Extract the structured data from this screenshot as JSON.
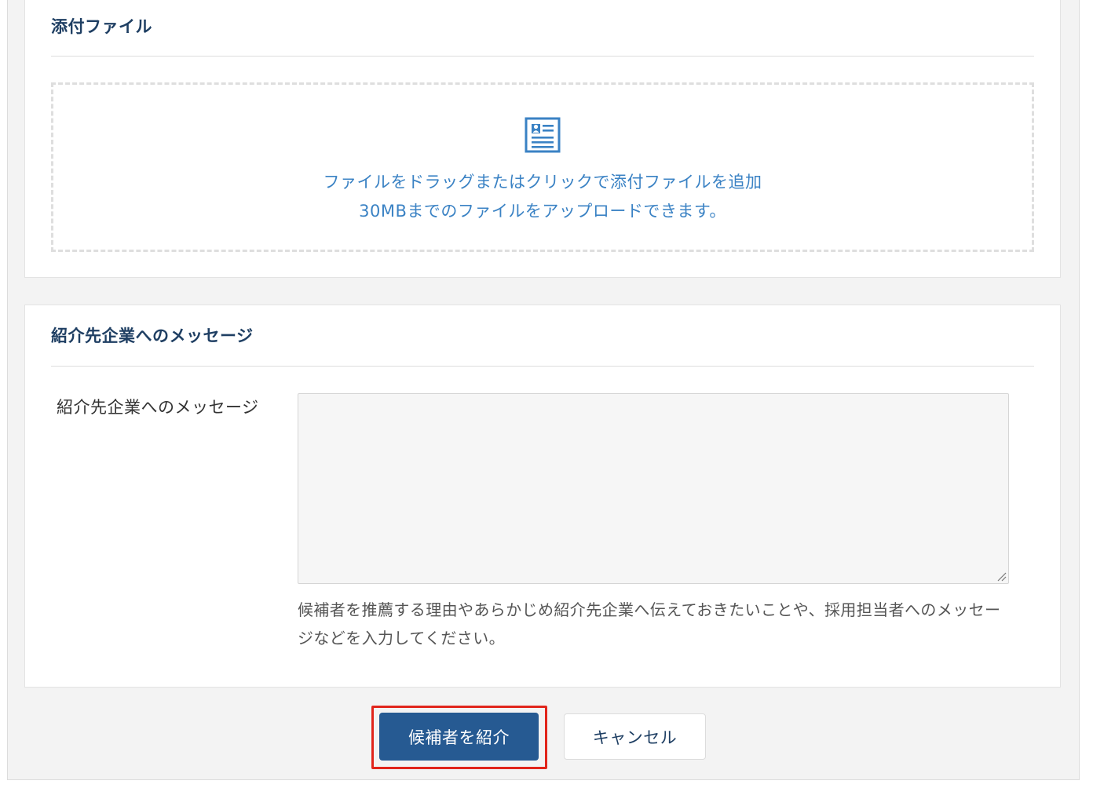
{
  "attachments": {
    "title": "添付ファイル",
    "dropzone_icon": "document-icon",
    "dropzone_line1": "ファイルをドラッグまたはクリックで添付ファイルを追加",
    "dropzone_line2": "30MBまでのファイルをアップロードできます。"
  },
  "message_section": {
    "title": "紹介先企業へのメッセージ",
    "field_label": "紹介先企業へのメッセージ",
    "field_value": "",
    "help_text": "候補者を推薦する理由やあらかじめ紹介先企業へ伝えておきたいことや、採用担当者へのメッセージなどを入力してください。"
  },
  "actions": {
    "submit_label": "候補者を紹介",
    "cancel_label": "キャンセル"
  },
  "colors": {
    "primary": "#265a92",
    "heading": "#1f3f63",
    "link": "#3a82c4",
    "highlight": "#e1251b"
  }
}
